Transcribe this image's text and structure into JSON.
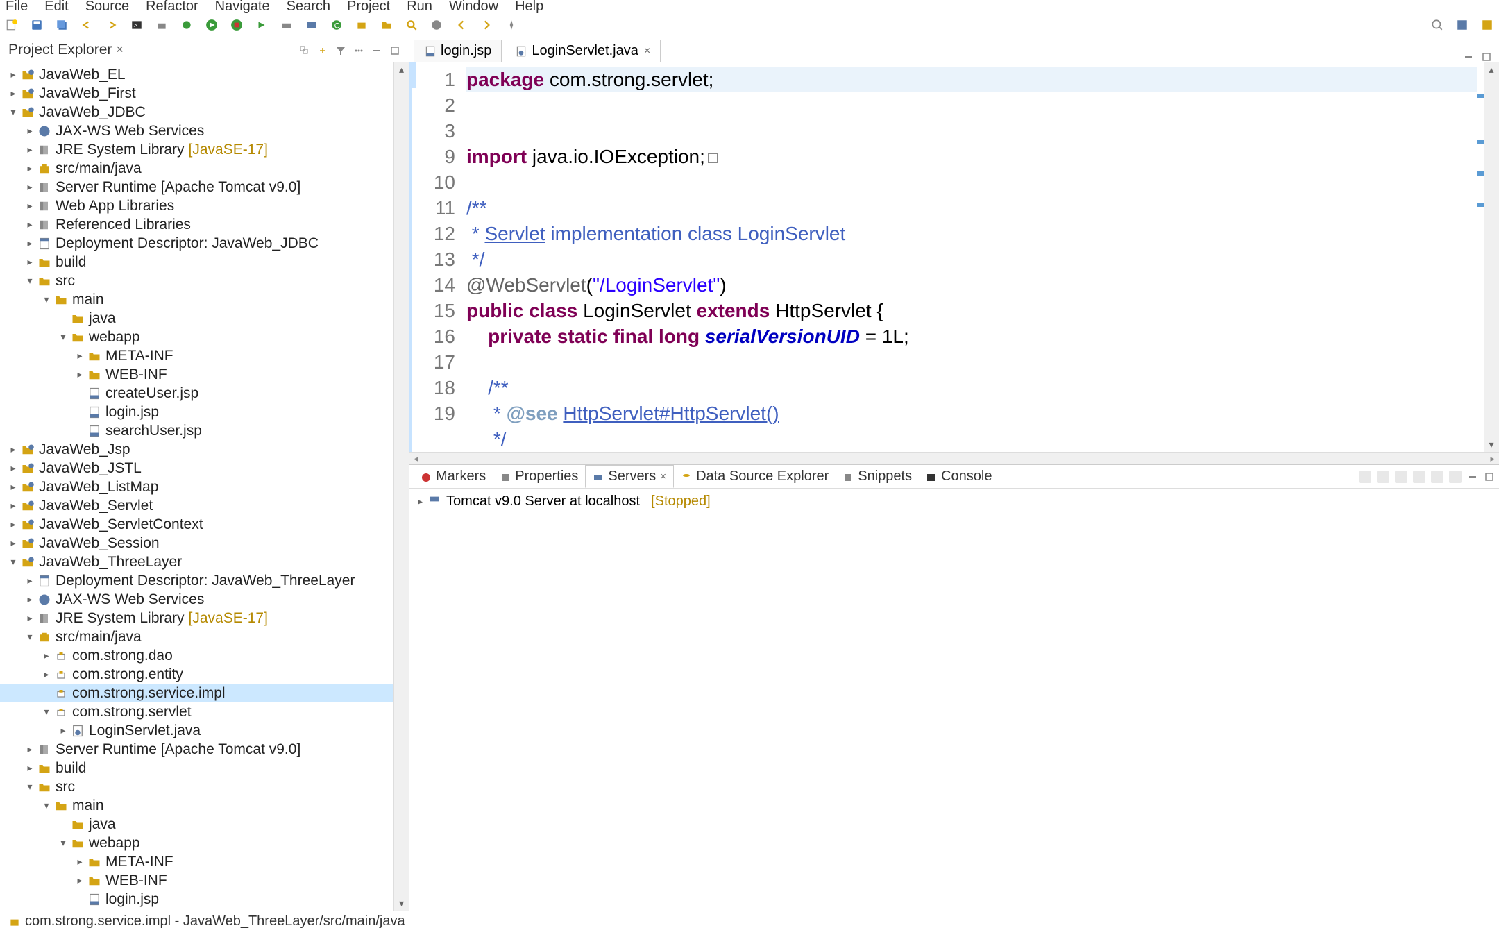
{
  "menu": [
    "File",
    "Edit",
    "Source",
    "Refactor",
    "Navigate",
    "Search",
    "Project",
    "Run",
    "Window",
    "Help"
  ],
  "explorer": {
    "title": "Project Explorer",
    "tree": [
      {
        "d": 0,
        "t": "collapsed",
        "i": "proj",
        "l": "JavaWeb_EL"
      },
      {
        "d": 0,
        "t": "collapsed",
        "i": "proj",
        "l": "JavaWeb_First"
      },
      {
        "d": 0,
        "t": "expanded",
        "i": "proj",
        "l": "JavaWeb_JDBC"
      },
      {
        "d": 1,
        "t": "collapsed",
        "i": "ws",
        "l": "JAX-WS Web Services"
      },
      {
        "d": 1,
        "t": "collapsed",
        "i": "lib",
        "l": "JRE System Library",
        "decor": "[JavaSE-17]"
      },
      {
        "d": 1,
        "t": "collapsed",
        "i": "pkg",
        "l": "src/main/java"
      },
      {
        "d": 1,
        "t": "collapsed",
        "i": "lib",
        "l": "Server Runtime [Apache Tomcat v9.0]"
      },
      {
        "d": 1,
        "t": "collapsed",
        "i": "lib",
        "l": "Web App Libraries"
      },
      {
        "d": 1,
        "t": "collapsed",
        "i": "lib",
        "l": "Referenced Libraries"
      },
      {
        "d": 1,
        "t": "collapsed",
        "i": "dd",
        "l": "Deployment Descriptor: JavaWeb_JDBC"
      },
      {
        "d": 1,
        "t": "collapsed",
        "i": "folder",
        "l": "build"
      },
      {
        "d": 1,
        "t": "expanded",
        "i": "folder",
        "l": "src"
      },
      {
        "d": 2,
        "t": "expanded",
        "i": "folder",
        "l": "main"
      },
      {
        "d": 3,
        "t": "none",
        "i": "folder",
        "l": "java"
      },
      {
        "d": 3,
        "t": "expanded",
        "i": "folder",
        "l": "webapp"
      },
      {
        "d": 4,
        "t": "collapsed",
        "i": "folder",
        "l": "META-INF"
      },
      {
        "d": 4,
        "t": "collapsed",
        "i": "folder",
        "l": "WEB-INF"
      },
      {
        "d": 4,
        "t": "none",
        "i": "jsp",
        "l": "createUser.jsp"
      },
      {
        "d": 4,
        "t": "none",
        "i": "jsp",
        "l": "login.jsp"
      },
      {
        "d": 4,
        "t": "none",
        "i": "jsp",
        "l": "searchUser.jsp"
      },
      {
        "d": 0,
        "t": "collapsed",
        "i": "proj",
        "l": "JavaWeb_Jsp"
      },
      {
        "d": 0,
        "t": "collapsed",
        "i": "proj",
        "l": "JavaWeb_JSTL"
      },
      {
        "d": 0,
        "t": "collapsed",
        "i": "proj",
        "l": "JavaWeb_ListMap"
      },
      {
        "d": 0,
        "t": "collapsed",
        "i": "proj",
        "l": "JavaWeb_Servlet"
      },
      {
        "d": 0,
        "t": "collapsed",
        "i": "proj",
        "l": "JavaWeb_ServletContext"
      },
      {
        "d": 0,
        "t": "collapsed",
        "i": "proj",
        "l": "JavaWeb_Session"
      },
      {
        "d": 0,
        "t": "expanded",
        "i": "proj",
        "l": "JavaWeb_ThreeLayer"
      },
      {
        "d": 1,
        "t": "collapsed",
        "i": "dd",
        "l": "Deployment Descriptor: JavaWeb_ThreeLayer"
      },
      {
        "d": 1,
        "t": "collapsed",
        "i": "ws",
        "l": "JAX-WS Web Services"
      },
      {
        "d": 1,
        "t": "collapsed",
        "i": "lib",
        "l": "JRE System Library",
        "decor": "[JavaSE-17]"
      },
      {
        "d": 1,
        "t": "expanded",
        "i": "pkg",
        "l": "src/main/java"
      },
      {
        "d": 2,
        "t": "collapsed",
        "i": "package",
        "l": "com.strong.dao"
      },
      {
        "d": 2,
        "t": "collapsed",
        "i": "package",
        "l": "com.strong.entity"
      },
      {
        "d": 2,
        "t": "none",
        "i": "package",
        "l": "com.strong.service.impl",
        "sel": true
      },
      {
        "d": 2,
        "t": "expanded",
        "i": "package",
        "l": "com.strong.servlet"
      },
      {
        "d": 3,
        "t": "collapsed",
        "i": "java",
        "l": "LoginServlet.java"
      },
      {
        "d": 1,
        "t": "collapsed",
        "i": "lib",
        "l": "Server Runtime [Apache Tomcat v9.0]"
      },
      {
        "d": 1,
        "t": "collapsed",
        "i": "folder",
        "l": "build"
      },
      {
        "d": 1,
        "t": "expanded",
        "i": "folder",
        "l": "src"
      },
      {
        "d": 2,
        "t": "expanded",
        "i": "folder",
        "l": "main"
      },
      {
        "d": 3,
        "t": "none",
        "i": "folder",
        "l": "java"
      },
      {
        "d": 3,
        "t": "expanded",
        "i": "folder",
        "l": "webapp"
      },
      {
        "d": 4,
        "t": "collapsed",
        "i": "folder",
        "l": "META-INF"
      },
      {
        "d": 4,
        "t": "collapsed",
        "i": "folder",
        "l": "WEB-INF"
      },
      {
        "d": 4,
        "t": "none",
        "i": "jsp",
        "l": "login.jsp"
      }
    ]
  },
  "editor": {
    "tabs": [
      {
        "label": "login.jsp",
        "active": false
      },
      {
        "label": "LoginServlet.java",
        "active": true
      }
    ],
    "lines": [
      "1",
      "2",
      "3",
      "9",
      "10",
      "11",
      "12",
      "13",
      "14",
      "15",
      "16",
      "17",
      "18",
      "19"
    ]
  },
  "bottom": {
    "tabs": [
      "Markers",
      "Properties",
      "Servers",
      "Data Source Explorer",
      "Snippets",
      "Console"
    ],
    "active": "Servers",
    "server_name": "Tomcat v9.0 Server at localhost",
    "server_status": "[Stopped]"
  },
  "status": {
    "text": "com.strong.service.impl - JavaWeb_ThreeLayer/src/main/java"
  },
  "code": {
    "l1a": "package",
    "l1b": " com.strong.servlet;",
    "l3a": "import",
    "l3b": " java.io.IOException;",
    "l10": "/**",
    "l11a": " * ",
    "l11b": "Servlet",
    "l11c": " implementation class LoginServlet",
    "l12": " */",
    "l13a": "@WebServlet",
    "l13b": "(",
    "l13c": "\"/LoginServlet\"",
    "l13d": ")",
    "l14a": "public class",
    "l14b": " LoginServlet ",
    "l14c": "extends",
    "l14d": " HttpServlet {",
    "l15a": "    private static final long",
    "l15b": " ",
    "l15c": "serialVersionUID",
    "l15d": " = 1L;",
    "l17": "    /**",
    "l18a": "     * ",
    "l18b": "@see",
    "l18c": " ",
    "l18d": "HttpServlet#HttpServlet()",
    "l19": "     */"
  }
}
